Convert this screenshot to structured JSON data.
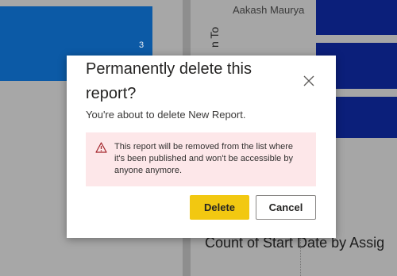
{
  "background": {
    "left_bar_value": "3",
    "author_name": "Aakash Maurya",
    "rotated_axis_label": "n To",
    "bottom_chart_title": "Count of Start Date by Assig",
    "colors": {
      "blue_bar_light": "#0c5aa6",
      "blue_bar_dark": "#0b1f7a"
    }
  },
  "dialog": {
    "title": "Permanently delete this report?",
    "close_icon": "close-icon",
    "subtitle": "You're about to delete New Report.",
    "warning": {
      "icon": "warning-triangle-icon",
      "text": "This report will be removed from the list where it's been published and won't be accessible by anyone anymore."
    },
    "buttons": {
      "delete_label": "Delete",
      "cancel_label": "Cancel"
    },
    "colors": {
      "delete_button": "#f2c811",
      "warning_background": "#fde7e9",
      "warning_icon": "#a4262c"
    }
  }
}
